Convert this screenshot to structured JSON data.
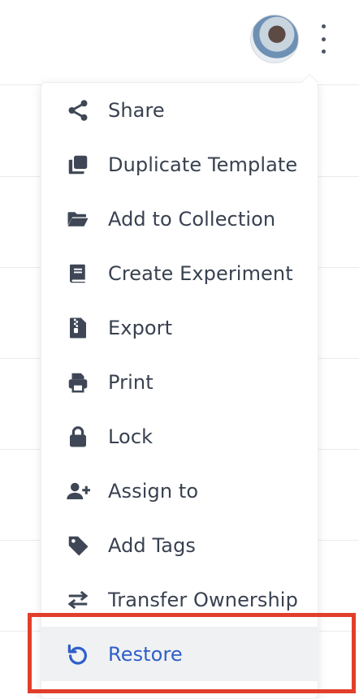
{
  "header": {
    "avatar_icon": "user-avatar",
    "more_icon": "kebab-vertical-icon"
  },
  "menu": {
    "items": [
      {
        "label": "Share",
        "icon": "share-icon"
      },
      {
        "label": "Duplicate Template",
        "icon": "duplicate-icon"
      },
      {
        "label": "Add to Collection",
        "icon": "folder-open-icon"
      },
      {
        "label": "Create Experiment",
        "icon": "book-icon"
      },
      {
        "label": "Export",
        "icon": "file-zip-icon"
      },
      {
        "label": "Print",
        "icon": "printer-icon"
      },
      {
        "label": "Lock",
        "icon": "lock-icon"
      },
      {
        "label": "Assign to",
        "icon": "user-plus-icon"
      },
      {
        "label": "Add Tags",
        "icon": "tag-icon"
      },
      {
        "label": "Transfer Ownership",
        "icon": "arrows-exchange-icon"
      },
      {
        "label": "Restore",
        "icon": "restore-icon",
        "highlighted": true
      }
    ]
  },
  "colors": {
    "text": "#394150",
    "accent": "#2f5fc9",
    "highlight_bg": "#f0f1f3",
    "annotation_border": "#e23e2b"
  }
}
